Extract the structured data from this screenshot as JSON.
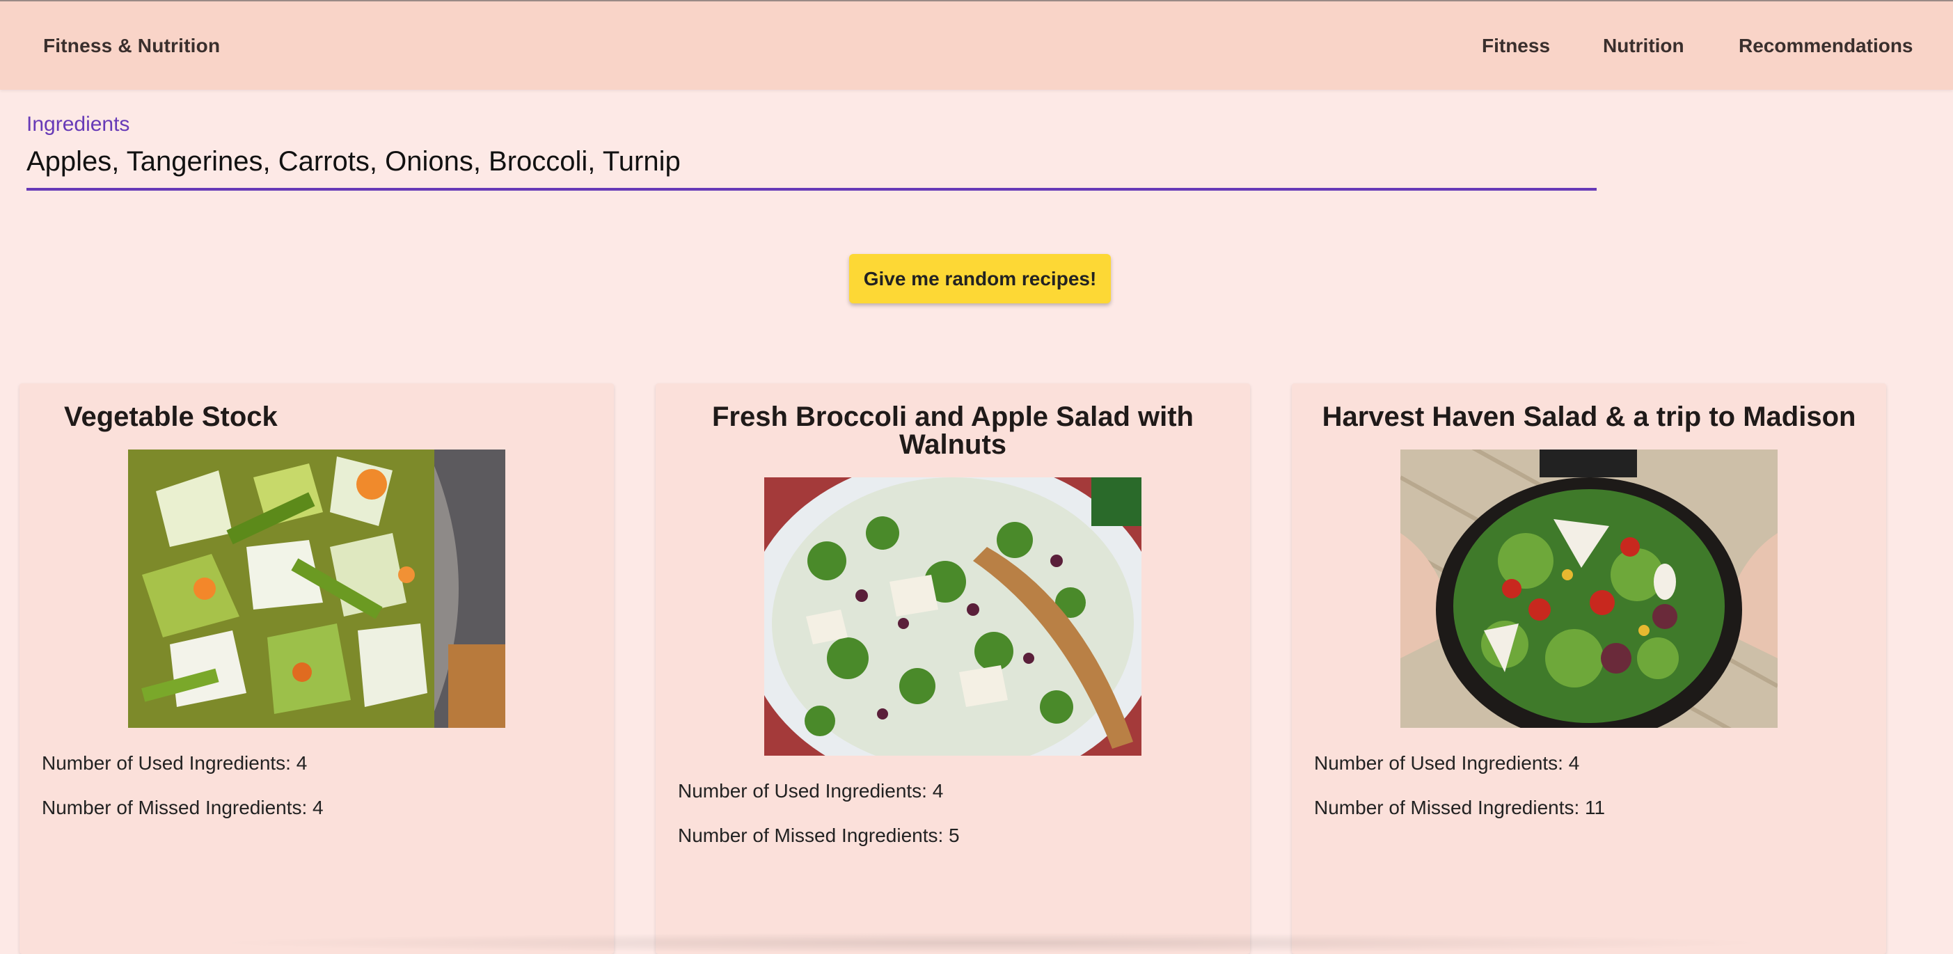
{
  "appbar": {
    "brand": "Fitness & Nutrition",
    "nav": [
      "Fitness",
      "Nutrition",
      "Recommendations"
    ]
  },
  "search": {
    "label": "Ingredients",
    "value": "Apples, Tangerines, Carrots, Onions, Broccoli, Turnip"
  },
  "random_button": "Give me random recipes!",
  "recipes": [
    {
      "title": "Vegetable Stock",
      "used": "Number of Used Ingredients: 4",
      "missed": "Number of Missed Ingredients: 4"
    },
    {
      "title": "Fresh Broccoli and Apple Salad with Walnuts",
      "used": "Number of Used Ingredients: 4",
      "missed": "Number of Missed Ingredients: 5"
    },
    {
      "title": "Harvest Haven Salad & a trip to Madison",
      "used": "Number of Used Ingredients: 4",
      "missed": "Number of Missed Ingredients: 11"
    }
  ],
  "colors": {
    "appbar": "#f9d4c8",
    "page": "#fde9e6",
    "card": "#fbe0da",
    "accent": "#673ab7",
    "button": "#fdd835"
  }
}
